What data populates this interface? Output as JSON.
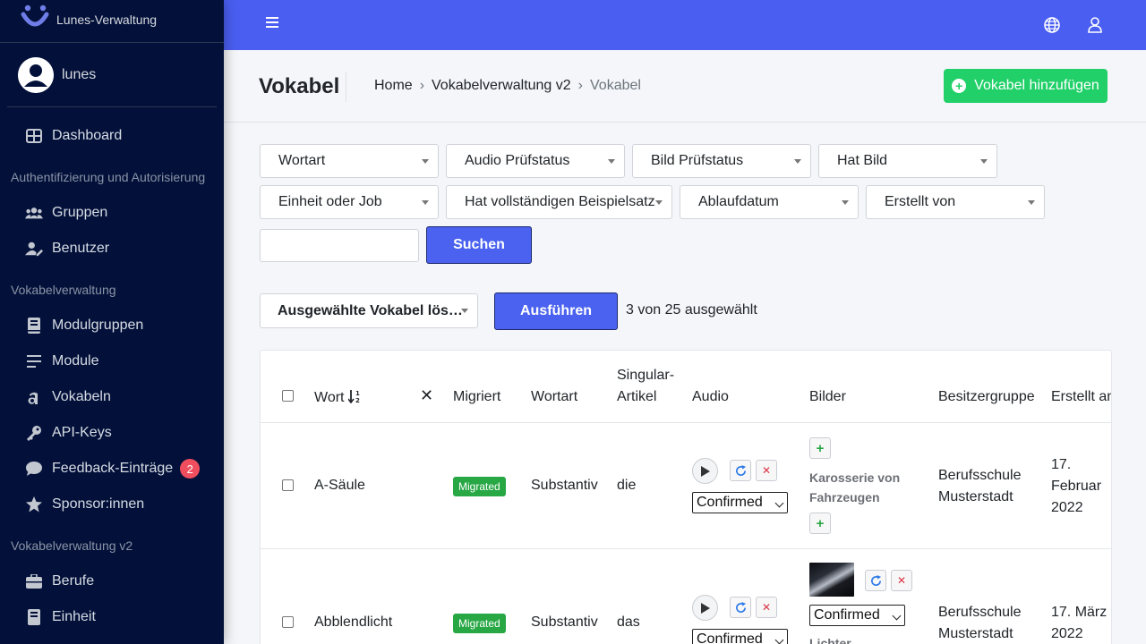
{
  "brand": {
    "name": "Lunes-Verwaltung"
  },
  "user": {
    "name": "lunes"
  },
  "sidebar": {
    "dashboard": "Dashboard",
    "section_auth": "Authentifizierung und Autorisierung",
    "groups": "Gruppen",
    "users": "Benutzer",
    "section_vocab": "Vokabelverwaltung",
    "module_groups": "Modulgruppen",
    "modules": "Module",
    "vocabulary": "Vokabeln",
    "api_keys": "API-Keys",
    "feedback": "Feedback-Einträge",
    "feedback_count": "2",
    "sponsors": "Sponsor:innen",
    "section_vocab_v2": "Vokabelverwaltung v2",
    "professions": "Berufe",
    "unit": "Einheit"
  },
  "header": {
    "title": "Vokabel",
    "breadcrumb": [
      "Home",
      "Vokabelverwaltung v2",
      "Vokabel"
    ],
    "add_button": "Vokabel hinzufügen"
  },
  "filters": {
    "word_type": "Wortart",
    "audio_status": "Audio Prüfstatus",
    "image_status": "Bild Prüfstatus",
    "has_image": "Hat Bild",
    "unit_or_job": "Einheit oder Job",
    "has_full_example": "Hat vollständigen Beispielsatz",
    "expiry_date": "Ablaufdatum",
    "created_by": "Erstellt von",
    "search_value": "",
    "search_button": "Suchen"
  },
  "actions": {
    "selected_action": "Ausgewählte Vokabel lös…",
    "run_button": "Ausführen",
    "selection_count": "3 von 25 ausgewählt"
  },
  "table": {
    "headers": {
      "word": "Wort",
      "migrated": "Migriert",
      "word_type": "Wortart",
      "singular_article_1": "Singular-",
      "singular_article_2": "Artikel",
      "audio": "Audio",
      "images": "Bilder",
      "owner_group": "Besitzergruppe",
      "created_at": "Erstellt am"
    },
    "rows": [
      {
        "word": "A-Säule",
        "migrated": "Migrated",
        "word_type": "Substantiv",
        "article": "die",
        "audio_status": "Confirmed",
        "image_label_1": "Karosserie von",
        "image_label_2": "Fahrzeugen",
        "owner_1": "Berufsschule",
        "owner_2": "Musterstadt",
        "date_1": "17.",
        "date_2": "Februar",
        "date_3": "2022"
      },
      {
        "word": "Abblendlicht",
        "migrated": "Migrated",
        "word_type": "Substantiv",
        "article": "das",
        "audio_status": "Confirmed",
        "image_status": "Confirmed",
        "image_label_1": "Lichter",
        "owner_1": "Berufsschule",
        "owner_2": "Musterstadt",
        "date_1": "17. März",
        "date_2": "2022"
      }
    ]
  }
}
